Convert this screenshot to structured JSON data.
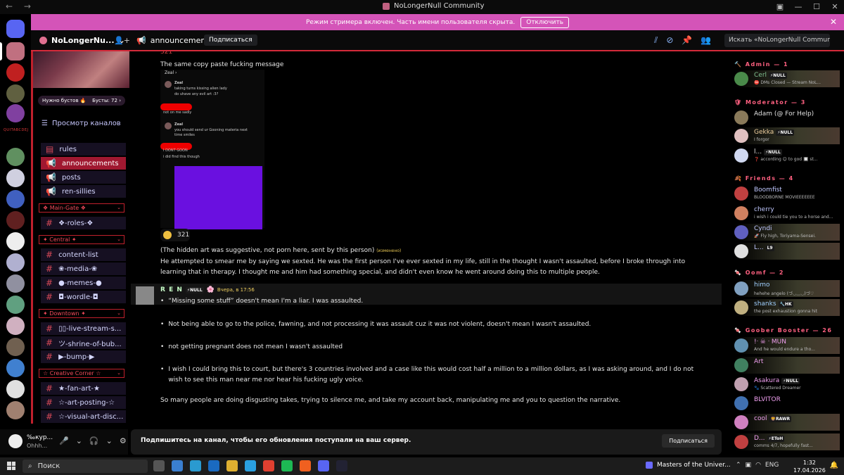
{
  "window": {
    "title": "NoLongerNull Community",
    "nav": "← →",
    "controls": [
      "▣",
      "—",
      "☐",
      "✕"
    ]
  },
  "banner": {
    "text": "Режим стримера включен. Часть имени пользователя скрыта.",
    "button": "Отключить",
    "close": "✕"
  },
  "header": {
    "server_name": "NoLongerNu...",
    "chevron": "⌄",
    "channel": "announcements",
    "subscribe": "Подписаться",
    "search_placeholder": "Искать «NoLongerNull Commun..."
  },
  "sidebar": {
    "boost_left": "Нужно бустов 🔥",
    "boost_right": "Бусты: 72 ›",
    "browse": "Просмотр каналов",
    "channels_top": [
      {
        "name": "rules",
        "active": false
      },
      {
        "name": "announcements",
        "active": true
      },
      {
        "name": "posts",
        "active": false
      },
      {
        "name": "ren-sillies",
        "active": false
      }
    ],
    "categories": [
      {
        "name": "❖ Main-Gate ❖",
        "channels": [
          "❖-roles-❖"
        ]
      },
      {
        "name": "✦ Central ✦",
        "channels": [
          "content-list",
          "❀-media-❀",
          "●-memes-●",
          "◘-wordle-◘"
        ]
      },
      {
        "name": "✦ Downtown ✦",
        "channels": [
          "▯▯-live-stream-s...",
          "ツ-shrine-of-bub...",
          "▶-bump-▶"
        ]
      },
      {
        "name": "☆ Creative Corner ☆",
        "channels": [
          "★-fan-art-★",
          "☆-art-posting-☆",
          "☆-visual-art-disc..."
        ]
      }
    ],
    "rail_label": "QUITABCDEJ"
  },
  "user": {
    "name": "‰кур...",
    "status": "Ohhh...",
    "controls": [
      "🎤",
      "⌄",
      "🎧",
      "⌄",
      "⚙"
    ]
  },
  "messages": {
    "top_reaction_count": "321",
    "caption": "The same copy paste fucking message",
    "embed": {
      "header": "Zeal ›",
      "lines": [
        {
          "who": "Zeal",
          "text": "taking turns kissing alien lady"
        },
        {
          "who": "",
          "text": "do uhave any evil art :3?"
        },
        {
          "who": "",
          "text": "not on me sadly"
        },
        {
          "who": "Zeal",
          "text": "you should send ur Gooning materia next time smiles"
        },
        {
          "who": "",
          "text": "I DONT GOON"
        },
        {
          "who": "",
          "text": "i did find this though"
        }
      ]
    },
    "reaction_count": "321",
    "note": "(The hidden art was suggestive, not porn here, sent by this person)",
    "edited": "(изменено)",
    "paragraph": "He attempted to smear me by saying we sexted. He was the first person I've ever sexted in my life, still in the thought I wasn't assaulted, before I broke through into learning that in therapy. I thought me and him had something special, and didn't even know he went around doing this to multiple people.",
    "ren": {
      "name": "R E N",
      "tag": "⚡NULL",
      "time": "Вчера, в 17:56",
      "bullets": [
        "“Missing some stuff” doesn't mean I'm a liar. I was assaulted.",
        "Not being able to go to the police, fawning, and not processing it was assault cuz it was not violent, doesn't mean I wasn't assaulted.",
        "not getting pregnant does not mean I wasn't assaulted",
        "I wish I could bring this to court, but there's 3 countries involved and a case like this would cost half a million to a million dollars, as I was asking around, and I do not wish to see this man near me nor hear his fucking ugly voice."
      ],
      "closing": "So many people are doing disgusting takes, trying to silence me, and take my account back, manipulating me and you to question the narrative."
    }
  },
  "subbar": {
    "text": "Подпишитесь на канал, чтобы его обновления поступали на ваш сервер.",
    "button": "Подписаться"
  },
  "members": {
    "groups": [
      {
        "title": "🔨 Admin — 1",
        "members": [
          {
            "name": "Cerl",
            "tag": "⚡NULL",
            "status": "⛔ DMs Closed — Stream NoL..."
          }
        ]
      },
      {
        "title": "🛡 Moderator — 3",
        "members": [
          {
            "name": "Adam (@ For Help)",
            "tag": "",
            "status": ""
          },
          {
            "name": "Gekka",
            "tag": "⚡NULL",
            "status": "I forgor"
          },
          {
            "name": "l...",
            "tag": "⚡NULL",
            "status": "❓ according 😊 to god 🔲 st..."
          }
        ]
      },
      {
        "title": "🍂 Friends — 4",
        "members": [
          {
            "name": "Boomfist",
            "tag": "",
            "status": "BLOODBORNE MOVIEEEEEEE"
          },
          {
            "name": "cherry",
            "tag": "",
            "status": "i wish i could tie you to a horse and..."
          },
          {
            "name": "Cyndi",
            "tag": "",
            "status": "🚀 Fly high, Toriyama-Sensei."
          },
          {
            "name": "L...",
            "tag": "L9",
            "status": ""
          }
        ]
      },
      {
        "title": "🍬 Oomf — 2",
        "members": [
          {
            "name": "himo",
            "tag": "",
            "status": "hehehe angelo (づ◡﹏◡)づ♡"
          },
          {
            "name": "shanks",
            "tag": "🔧HK",
            "status": "the post exhaustion gonna hit"
          }
        ]
      },
      {
        "title": "🍬 Goober Booster — 26",
        "members": [
          {
            "name": "!ᐧ ☠ ᐧ MUN",
            "tag": "",
            "status": "And he would endure a tho..."
          },
          {
            "name": "Art",
            "tag": "",
            "status": ""
          },
          {
            "name": "Asakura",
            "tag": "⚡NULL",
            "status": "🐾 Scattered Dreamer"
          },
          {
            "name": "BLVITOR",
            "tag": "",
            "status": ""
          },
          {
            "name": "cool",
            "tag": "🦁RAWR",
            "status": ""
          },
          {
            "name": "D...",
            "tag": "⚡EToH",
            "status": "comms 4/7, hopefully fast..."
          }
        ]
      }
    ]
  },
  "taskbar": {
    "search": "Поиск",
    "media": "Masters of the Univer...",
    "lang": "ENG",
    "time": "1:32",
    "date": "17.04.2026"
  }
}
